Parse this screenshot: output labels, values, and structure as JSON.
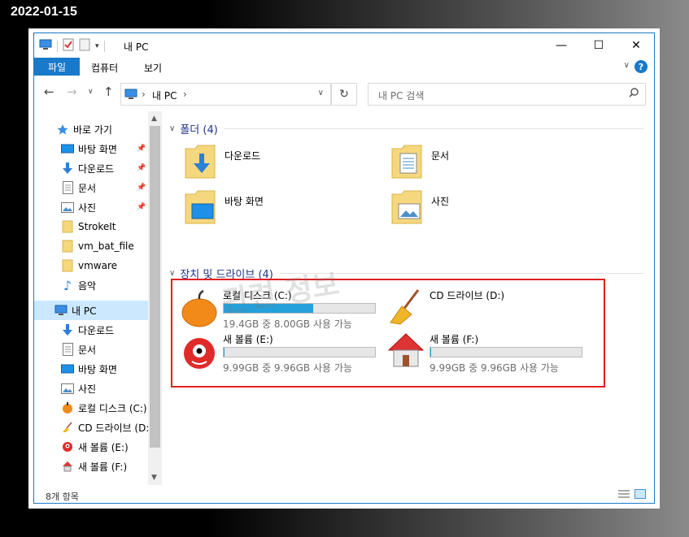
{
  "date_stamp": "2022-01-15",
  "window": {
    "title": "내 PC",
    "controls": {
      "minimize": "—",
      "maximize": "☐",
      "close": "✕"
    }
  },
  "ribbon": {
    "file_tab": "파일",
    "tabs": [
      "컴퓨터",
      "보기"
    ]
  },
  "address": {
    "location": "내 PC",
    "search_placeholder": "내 PC 검색"
  },
  "navigation": {
    "quick_access": "바로 가기",
    "items": [
      {
        "label": "바탕 화면",
        "icon": "desktop-icon",
        "pinned": true
      },
      {
        "label": "다운로드",
        "icon": "download-icon",
        "pinned": true
      },
      {
        "label": "문서",
        "icon": "document-icon",
        "pinned": true
      },
      {
        "label": "사진",
        "icon": "picture-icon",
        "pinned": true
      },
      {
        "label": "StrokeIt",
        "icon": "folder-icon",
        "pinned": false
      },
      {
        "label": "vm_bat_file",
        "icon": "folder-icon",
        "pinned": false
      },
      {
        "label": "vmware",
        "icon": "folder-icon",
        "pinned": false
      },
      {
        "label": "음악",
        "icon": "music-icon",
        "pinned": false
      }
    ],
    "this_pc": "내 PC",
    "pc_items": [
      {
        "label": "다운로드",
        "icon": "download-icon"
      },
      {
        "label": "문서",
        "icon": "document-icon"
      },
      {
        "label": "바탕 화면",
        "icon": "desktop-icon"
      },
      {
        "label": "사진",
        "icon": "picture-icon"
      },
      {
        "label": "로컬 디스크 (C:)",
        "icon": "orange-drive-icon"
      },
      {
        "label": "CD 드라이브 (D:)",
        "icon": "broom-drive-icon"
      },
      {
        "label": "새 볼륨 (E:)",
        "icon": "red-monster-drive-icon"
      },
      {
        "label": "새 볼륨 (F:)",
        "icon": "house-drive-icon"
      }
    ]
  },
  "folders": {
    "header": "폴더 (4)",
    "items": [
      {
        "label": "다운로드",
        "icon": "download-folder-icon"
      },
      {
        "label": "문서",
        "icon": "document-folder-icon"
      },
      {
        "label": "바탕 화면",
        "icon": "desktop-folder-icon"
      },
      {
        "label": "사진",
        "icon": "picture-folder-icon"
      }
    ]
  },
  "devices": {
    "header": "장치 및 드라이브 (4)",
    "drives": [
      {
        "name": "로컬 디스크 (C:)",
        "info": "19.4GB 중 8.00GB 사용 가능",
        "used_fraction": 0.59,
        "icon": "orange-drive-icon"
      },
      {
        "name": "CD 드라이브 (D:)",
        "info": "",
        "used_fraction": null,
        "icon": "broom-drive-icon"
      },
      {
        "name": "새 볼륨 (E:)",
        "info": "9.99GB 중 9.96GB 사용 가능",
        "used_fraction": 0.003,
        "icon": "red-monster-drive-icon"
      },
      {
        "name": "새 볼륨 (F:)",
        "info": "9.99GB 중 9.96GB 사용 가능",
        "used_fraction": 0.003,
        "icon": "house-drive-icon"
      }
    ]
  },
  "watermark": "관련 정보",
  "status": {
    "item_count": "8개 항목"
  },
  "colors": {
    "accent": "#1979ca",
    "selection": "#cce8ff",
    "highlight_box": "#e02020",
    "usage_bar": "#26a0da"
  }
}
